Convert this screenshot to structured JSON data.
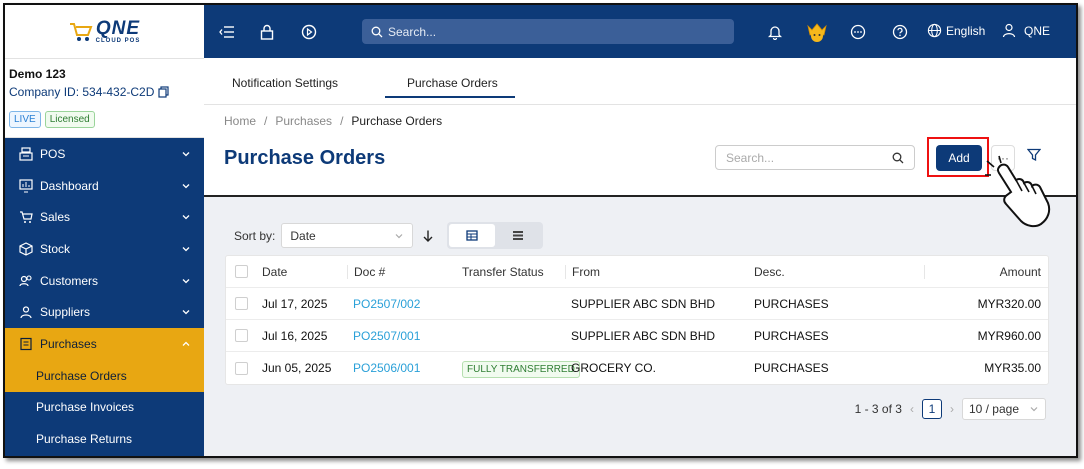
{
  "app": {
    "logo_main": "QNE",
    "logo_sub": "CLOUD POS"
  },
  "company": {
    "name": "Demo 123",
    "id_text": "Company ID: 534-432-C2D",
    "badge_live": "LIVE",
    "badge_licensed": "Licensed"
  },
  "sidebar": {
    "items": [
      {
        "label": "POS",
        "icon": "register-icon"
      },
      {
        "label": "Dashboard",
        "icon": "monitor-chart-icon"
      },
      {
        "label": "Sales",
        "icon": "cart-icon"
      },
      {
        "label": "Stock",
        "icon": "box-icon"
      },
      {
        "label": "Customers",
        "icon": "users-icon"
      },
      {
        "label": "Suppliers",
        "icon": "user-icon"
      },
      {
        "label": "Purchases",
        "icon": "clipboard-icon"
      }
    ],
    "sub_items": [
      {
        "label": "Purchase Orders"
      },
      {
        "label": "Purchase Invoices"
      },
      {
        "label": "Purchase Returns"
      }
    ]
  },
  "topbar": {
    "search_placeholder": "Search...",
    "language": "English",
    "user": "QNE"
  },
  "tabs": [
    {
      "label": "Notification Settings"
    },
    {
      "label": "Purchase Orders"
    }
  ],
  "breadcrumb": {
    "home": "Home",
    "purchases": "Purchases",
    "current": "Purchase Orders",
    "separator": "/"
  },
  "page": {
    "title": "Purchase Orders",
    "search_placeholder": "Search...",
    "add_label": "Add",
    "more_label": "···"
  },
  "sort": {
    "label": "Sort by:",
    "value": "Date"
  },
  "table": {
    "headers": [
      "Date",
      "Doc #",
      "Transfer Status",
      "From",
      "Desc.",
      "Amount"
    ],
    "rows": [
      {
        "date": "Jul 17, 2025",
        "doc": "PO2507/002",
        "status": "",
        "from": "SUPPLIER ABC SDN BHD",
        "desc": "PURCHASES",
        "amount": "MYR320.00"
      },
      {
        "date": "Jul 16, 2025",
        "doc": "PO2507/001",
        "status": "",
        "from": "SUPPLIER ABC SDN BHD",
        "desc": "PURCHASES",
        "amount": "MYR960.00"
      },
      {
        "date": "Jun 05, 2025",
        "doc": "PO2506/001",
        "status": "FULLY TRANSFERRED",
        "from": "GROCERY CO.",
        "desc": "PURCHASES",
        "amount": "MYR35.00"
      }
    ]
  },
  "pagination": {
    "range": "1 - 3 of 3",
    "current_page": "1",
    "page_size": "10 / page"
  },
  "colors": {
    "primary": "#0d3a78",
    "accent": "#e8a712",
    "highlight": "#e11111"
  }
}
